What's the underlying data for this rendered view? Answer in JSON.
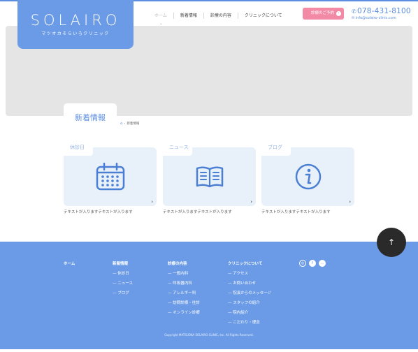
{
  "header": {
    "logo": {
      "main": "SOLAIRO",
      "sub": "マツオカそらいろクリニック"
    },
    "nav": [
      {
        "label": "ホーム",
        "active": true
      },
      {
        "label": "新着情報",
        "active": false
      },
      {
        "label": "診療の内容",
        "active": false
      },
      {
        "label": "クリニックについて",
        "active": false
      }
    ],
    "reserve_label": "診療のご予約",
    "phone": "078-431-8100",
    "email": "info@solairo-clinic.com"
  },
  "page": {
    "title": "新着情報",
    "breadcrumb_current": "新着情報"
  },
  "cards": [
    {
      "label": "休診日",
      "icon": "calendar-icon",
      "text": "テキストが入りますテキストが入ります"
    },
    {
      "label": "ニュース",
      "icon": "book-icon",
      "text": "テキストが入りますテキストが入ります"
    },
    {
      "label": "ブログ",
      "icon": "info-icon",
      "text": "テキストが入りますテキストが入ります"
    }
  ],
  "footer": {
    "columns": [
      {
        "head": "ホーム",
        "items": []
      },
      {
        "head": "新着情報",
        "items": [
          "休診日",
          "ニュース",
          "ブログ"
        ]
      },
      {
        "head": "診療の内容",
        "items": [
          "一般内科",
          "呼吸器内科",
          "アレルギー科",
          "訪問診療・往診",
          "オンライン診療"
        ]
      },
      {
        "head": "クリニックについて",
        "items": [
          "アクセス",
          "お問い合わせ",
          "院長からのメッセージ",
          "スタッフの紹介",
          "院内紹介",
          "こだわり・理念"
        ]
      }
    ],
    "social": [
      "instagram-icon",
      "facebook-icon",
      "line-icon"
    ],
    "copyright": "Copyright MATSUOKA SOLAIRO CLINIC, Inc. All Rights Reserved."
  },
  "colors": {
    "accent": "#6b9be6",
    "reserve": "#f28aa6",
    "card_bg": "#e8f1fa",
    "hero_bg": "#e5e5e5"
  }
}
